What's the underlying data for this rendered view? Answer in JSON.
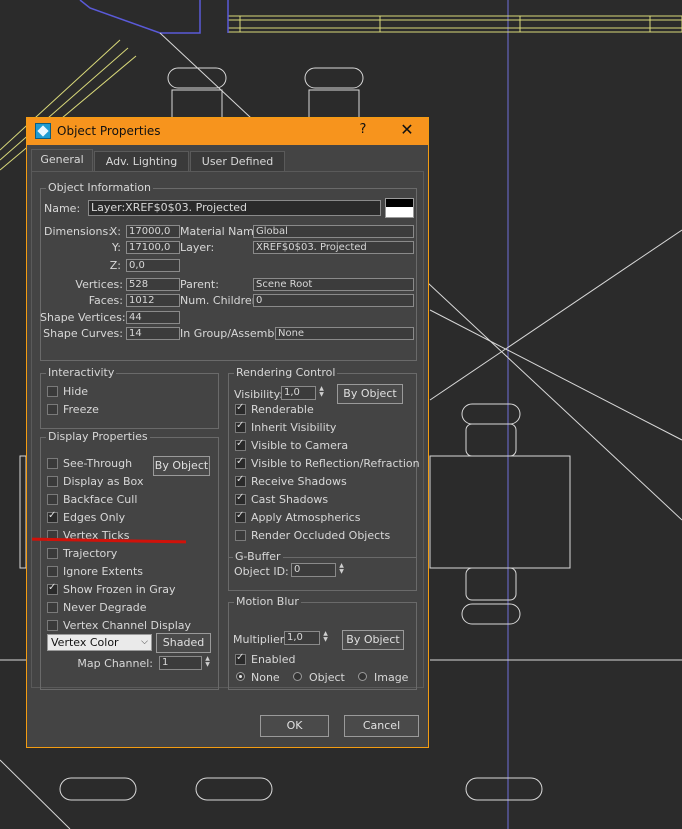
{
  "title": "Object Properties",
  "help_glyph": "?",
  "tabs": [
    "General",
    "Adv. Lighting",
    "User Defined"
  ],
  "object_info": {
    "group_title": "Object Information",
    "name_label": "Name:",
    "name_value": "Layer:XREF$0$03. Projected",
    "dimensions_label": "Dimensions:",
    "x_label": "X:",
    "x_value": "17000,0",
    "y_label": "Y:",
    "y_value": "17100,0",
    "z_label": "Z:",
    "z_value": "0,0",
    "material_label": "Material Name:",
    "material_value": "Global",
    "layer_label": "Layer:",
    "layer_value": "XREF$0$03. Projected",
    "vertices_label": "Vertices:",
    "vertices_value": "528",
    "faces_label": "Faces:",
    "faces_value": "1012",
    "shape_vertices_label": "Shape Vertices:",
    "shape_vertices_value": "44",
    "shape_curves_label": "Shape Curves:",
    "shape_curves_value": "14",
    "parent_label": "Parent:",
    "parent_value": "Scene Root",
    "num_children_label": "Num. Children:",
    "num_children_value": "0",
    "in_group_label": "In Group/Assembly:",
    "in_group_value": "None"
  },
  "interactivity": {
    "group_title": "Interactivity",
    "hide": "Hide",
    "hide_checked": false,
    "freeze": "Freeze",
    "freeze_checked": false
  },
  "display_properties": {
    "group_title": "Display Properties",
    "by_object": "By Object",
    "items": [
      {
        "label": "See-Through",
        "checked": false
      },
      {
        "label": "Display as Box",
        "checked": false
      },
      {
        "label": "Backface Cull",
        "checked": false
      },
      {
        "label": "Edges Only",
        "checked": true
      },
      {
        "label": "Vertex Ticks",
        "checked": false
      },
      {
        "label": "Trajectory",
        "checked": false
      },
      {
        "label": "Ignore Extents",
        "checked": false
      },
      {
        "label": "Show Frozen in Gray",
        "checked": true
      },
      {
        "label": "Never Degrade",
        "checked": false
      },
      {
        "label": "Vertex Channel Display",
        "checked": false
      }
    ],
    "vertex_color": "Vertex Color",
    "shaded": "Shaded",
    "map_channel_label": "Map Channel:",
    "map_channel_value": "1"
  },
  "rendering_control": {
    "group_title": "Rendering Control",
    "visibility_label": "Visibility:",
    "visibility_value": "1,0",
    "by_object": "By Object",
    "items": [
      {
        "label": "Renderable",
        "checked": true
      },
      {
        "label": "Inherit Visibility",
        "checked": true
      },
      {
        "label": "Visible to Camera",
        "checked": true
      },
      {
        "label": "Visible to Reflection/Refraction",
        "checked": true
      },
      {
        "label": "Receive Shadows",
        "checked": true
      },
      {
        "label": "Cast Shadows",
        "checked": true
      },
      {
        "label": "Apply Atmospherics",
        "checked": true
      },
      {
        "label": "Render Occluded Objects",
        "checked": false
      }
    ]
  },
  "gbuffer": {
    "group_title": "G-Buffer",
    "object_id_label": "Object ID:",
    "object_id_value": "0"
  },
  "motion_blur": {
    "group_title": "Motion Blur",
    "multiplier_label": "Multiplier:",
    "multiplier_value": "1,0",
    "by_object": "By Object",
    "enabled": "Enabled",
    "enabled_checked": true,
    "none": "None",
    "object": "Object",
    "image": "Image",
    "selected": "None"
  },
  "ok": "OK",
  "cancel": "Cancel",
  "colors": {
    "titlebar": "#f7941d",
    "dialog_bg": "#444444",
    "viewport_bg": "#2b2b2b",
    "annotation_line": "#d0120a"
  }
}
